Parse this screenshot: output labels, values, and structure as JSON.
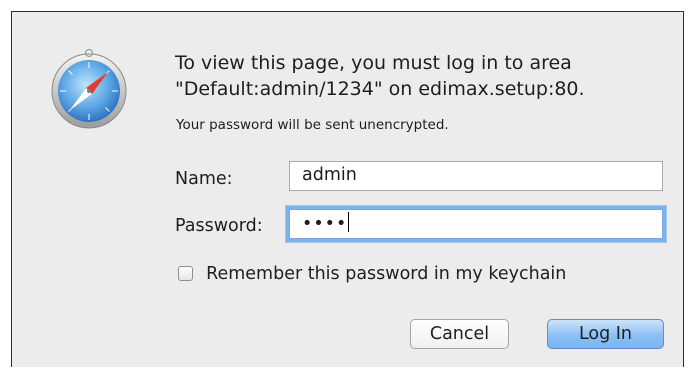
{
  "dialog": {
    "icon": "safari-compass-icon",
    "message_lines": [
      "To view this page, you must log in to area",
      "\"Default:admin/1234\" on edimax.setup:80."
    ],
    "note": "Your password will be sent unencrypted."
  },
  "form": {
    "name_label": "Name:",
    "name_value": "admin",
    "password_label": "Password:",
    "password_masked": "••••",
    "remember_label": "Remember this password in my keychain",
    "remember_checked": false
  },
  "buttons": {
    "cancel_label": "Cancel",
    "login_label": "Log In"
  },
  "colors": {
    "dialog_background": "#ececec",
    "focus_ring": "#7db3ea",
    "default_button": "#8cc0f4"
  }
}
